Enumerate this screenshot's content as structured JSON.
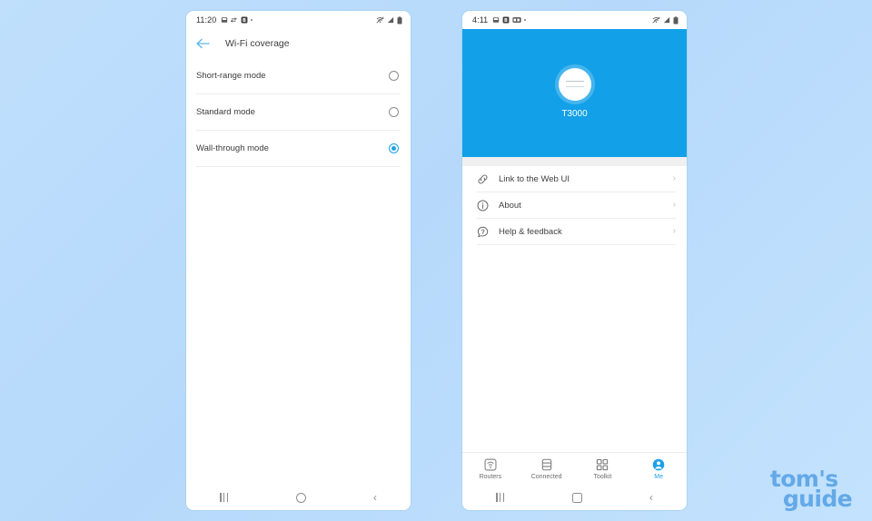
{
  "background": {
    "color_top_left": "#bfdffc",
    "color_bottom_right": "#c3e2fd"
  },
  "accent": {
    "blue": "#1ca1e6",
    "hero_blue": "#12a0e8",
    "logo_blue": "#63a9e8"
  },
  "phone_left": {
    "statusbar": {
      "time": "11:20",
      "left_icons": [
        "screenshot-icon",
        "transfer-icon",
        "b-badge-icon",
        "dot-icon"
      ],
      "right_icons": [
        "wifi-off-icon",
        "signal-icon",
        "battery-icon"
      ]
    },
    "appbar": {
      "back_icon": "back-arrow-icon",
      "title": "Wi-Fi coverage"
    },
    "options": [
      {
        "label": "Short-range mode",
        "selected": false
      },
      {
        "label": "Standard mode",
        "selected": false
      },
      {
        "label": "Wall-through mode",
        "selected": true
      }
    ],
    "navbar": {
      "recents": "recents-icon",
      "home": "home-circle-icon",
      "back": "back-chevron-icon"
    }
  },
  "phone_right": {
    "statusbar": {
      "time": "4:11",
      "left_icons": [
        "screenshot-icon",
        "b-badge-icon",
        "hd-badge-icon",
        "dot-icon"
      ],
      "right_icons": [
        "wifi-off-icon",
        "signal-icon",
        "battery-icon"
      ]
    },
    "hero": {
      "device_icon": "router-icon",
      "device_name": "T3000"
    },
    "menu": [
      {
        "icon": "link-icon",
        "label": "Link to the Web UI",
        "chevron": "chevron-right-icon"
      },
      {
        "icon": "info-icon",
        "label": "About",
        "chevron": "chevron-right-icon"
      },
      {
        "icon": "help-chat-icon",
        "label": "Help & feedback",
        "chevron": "chevron-right-icon"
      }
    ],
    "tabs": [
      {
        "label": "Routers",
        "icon": "router-tab-icon",
        "active": false
      },
      {
        "label": "Connected",
        "icon": "connected-tab-icon",
        "active": false
      },
      {
        "label": "Toolkit",
        "icon": "toolkit-tab-icon",
        "active": false
      },
      {
        "label": "Me",
        "icon": "profile-tab-icon",
        "active": true
      }
    ],
    "navbar": {
      "recents": "recents-icon",
      "home": "home-square-icon",
      "back": "back-chevron-icon"
    }
  },
  "brand": {
    "line1": "tom's",
    "line2": "guide"
  }
}
